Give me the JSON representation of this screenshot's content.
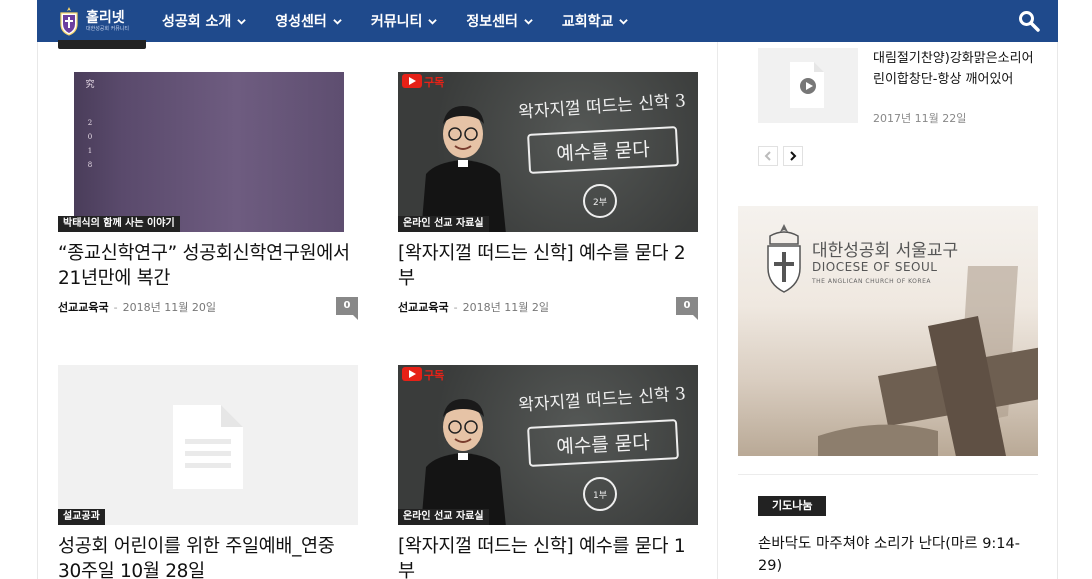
{
  "nav": {
    "logo_name": "홀리넷",
    "logo_sub": "대한성공회 커뮤니티",
    "menu": [
      {
        "label": "성공회 소개"
      },
      {
        "label": "영성센터"
      },
      {
        "label": "커뮤니티"
      },
      {
        "label": "정보센터"
      },
      {
        "label": "교회학교"
      }
    ],
    "search_icon": "search-icon"
  },
  "posts": [
    {
      "badge": "박태식의 함께 사는 이야기",
      "title": "“종교신학연구” 성공회신학연구원에서 21년만에 복간",
      "author": "선교교육국",
      "date": "2018년 11월 20일",
      "comments": "0",
      "thumb_type": "book",
      "spine_text": [
        "究",
        "2",
        "0",
        "1",
        "8"
      ]
    },
    {
      "badge": "온라인 선교 자료실",
      "title": "[왁자지껄 떠드는 신학] 예수를 묻다 2부",
      "author": "선교교육국",
      "date": "2018년 11월 2일",
      "comments": "0",
      "thumb_type": "video",
      "video": {
        "yt_label": "구독",
        "chalk_title": "왁자지껄 떠드는 신학 3",
        "banner": "예수를 묻다",
        "part": "2부"
      }
    },
    {
      "badge": "설교공과",
      "title": "성공회 어린이를 위한 주일예배_연중 30주일 10월 28일",
      "thumb_type": "placeholder"
    },
    {
      "badge": "온라인 선교 자료실",
      "title": "[왁자지껄 떠드는 신학] 예수를 묻다 1부",
      "thumb_type": "video",
      "video": {
        "yt_label": "구독",
        "chalk_title": "왁자지껄 떠드는 신학 3",
        "banner": "예수를 묻다",
        "part": "1부"
      }
    }
  ],
  "sidebar": {
    "recent": {
      "title": "대림절기찬양)강화맑은소리어린이합창단-항상 깨어있어",
      "date": "2017년 11월 22일"
    },
    "banner": {
      "ko": "대한성공회 서울교구",
      "en": "DIOCESE OF SEOUL",
      "en_sub": "THE ANGLICAN CHURCH OF KOREA"
    },
    "prayer": {
      "badge": "기도나눔",
      "title": "손바닥도 마주쳐야 소리가 난다(마르 9:14-29)"
    }
  },
  "colors": {
    "nav_bg": "#1f4a8c",
    "badge_bg": "#222222",
    "youtube_red": "#e62117",
    "comment_bg": "#888888"
  }
}
